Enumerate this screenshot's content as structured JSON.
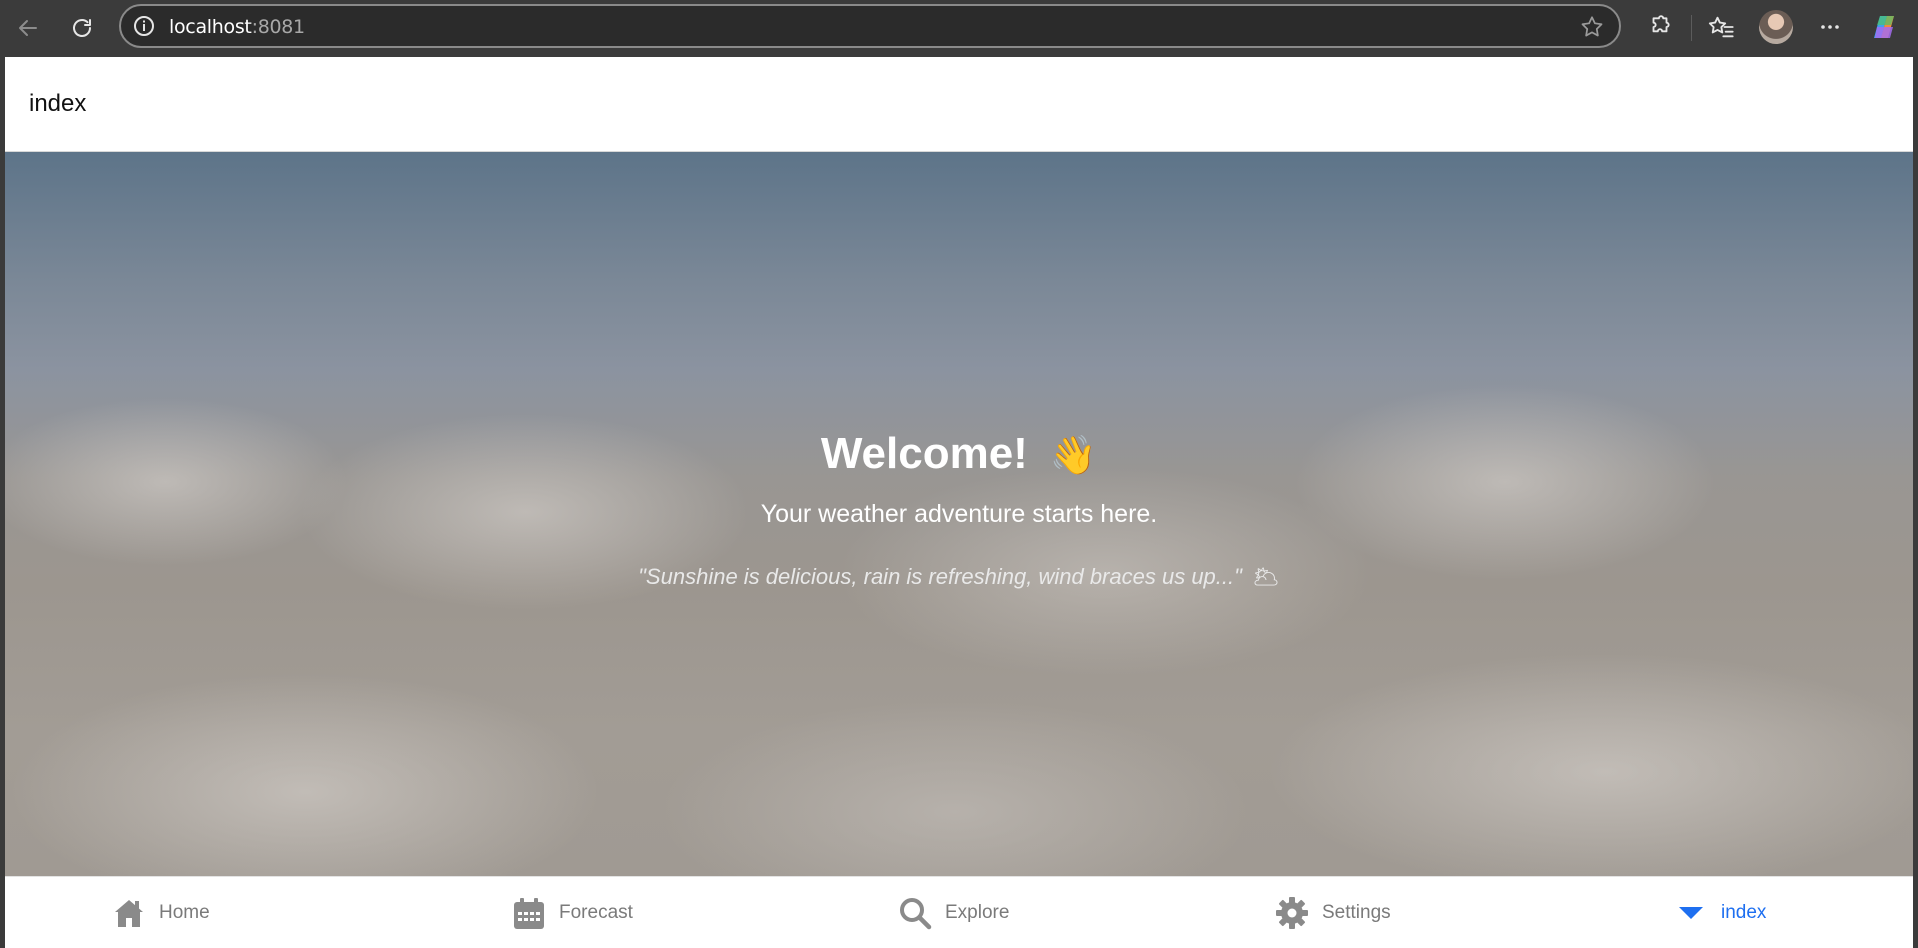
{
  "browser": {
    "url_host": "localhost",
    "url_port": ":8081"
  },
  "app": {
    "header_title": "index"
  },
  "hero": {
    "welcome": "Welcome!",
    "wave_emoji": "👋",
    "subtitle": "Your weather adventure starts here.",
    "quote": "\"Sunshine is delicious, rain is refreshing, wind braces us up...\"",
    "quote_emoji": "🌥"
  },
  "tabs": [
    {
      "label": "Home",
      "icon": "home-icon"
    },
    {
      "label": "Forecast",
      "icon": "calendar-icon"
    },
    {
      "label": "Explore",
      "icon": "search-icon"
    },
    {
      "label": "Settings",
      "icon": "gear-icon"
    },
    {
      "label": "index",
      "icon": "caret-down-icon",
      "active": true
    }
  ],
  "colors": {
    "active_tab": "#1e6ff0",
    "inactive_tab": "#7a7a7a",
    "browser_chrome": "#3b3b3b"
  }
}
